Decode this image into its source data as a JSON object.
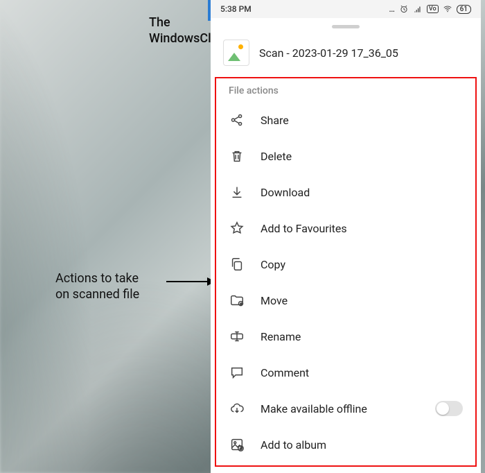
{
  "watermark": {
    "line1": "The",
    "line2": "WindowsClub"
  },
  "annotation": {
    "line1": "Actions to take",
    "line2": "on scanned file"
  },
  "statusbar": {
    "time": "5:38 PM",
    "battery": "61"
  },
  "file": {
    "name": "Scan - 2023-01-29 17_36_05"
  },
  "section_title": "File actions",
  "actions": {
    "share": "Share",
    "delete": "Delete",
    "download": "Download",
    "favourites": "Add to Favourites",
    "copy": "Copy",
    "move": "Move",
    "rename": "Rename",
    "comment": "Comment",
    "offline": "Make available offline",
    "album": "Add to album"
  },
  "offline_toggle": false
}
